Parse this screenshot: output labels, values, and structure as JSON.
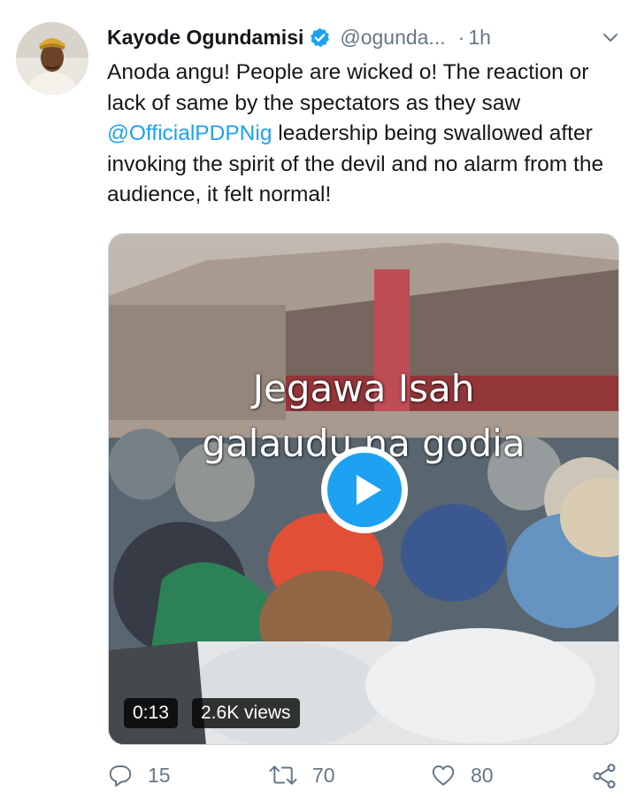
{
  "author": {
    "name": "Kayode Ogundamisi",
    "handle": "@ogunda...",
    "time_separator": "·",
    "time": "1h"
  },
  "tweet": {
    "text_before": "Anoda angu! People are wicked o! The reaction or lack of same by the spectators as they saw ",
    "mention": "@OfficialPDPNig",
    "text_after": " leadership being swallowed after invoking the spirit of the devil and no alarm from the audience, it felt normal!"
  },
  "media": {
    "overlay_line1": "Jegawa Isah",
    "overlay_line2": "galaudu na godia",
    "duration": "0:13",
    "views": "2.6K views"
  },
  "actions": {
    "replies": "15",
    "retweets": "70",
    "likes": "80"
  },
  "icons": [
    "verified-badge-icon",
    "chevron-down-icon",
    "play-icon",
    "reply-icon",
    "retweet-icon",
    "like-icon",
    "share-icon"
  ],
  "colors": {
    "accent": "#1da1f2",
    "secondary_text": "#657786"
  }
}
